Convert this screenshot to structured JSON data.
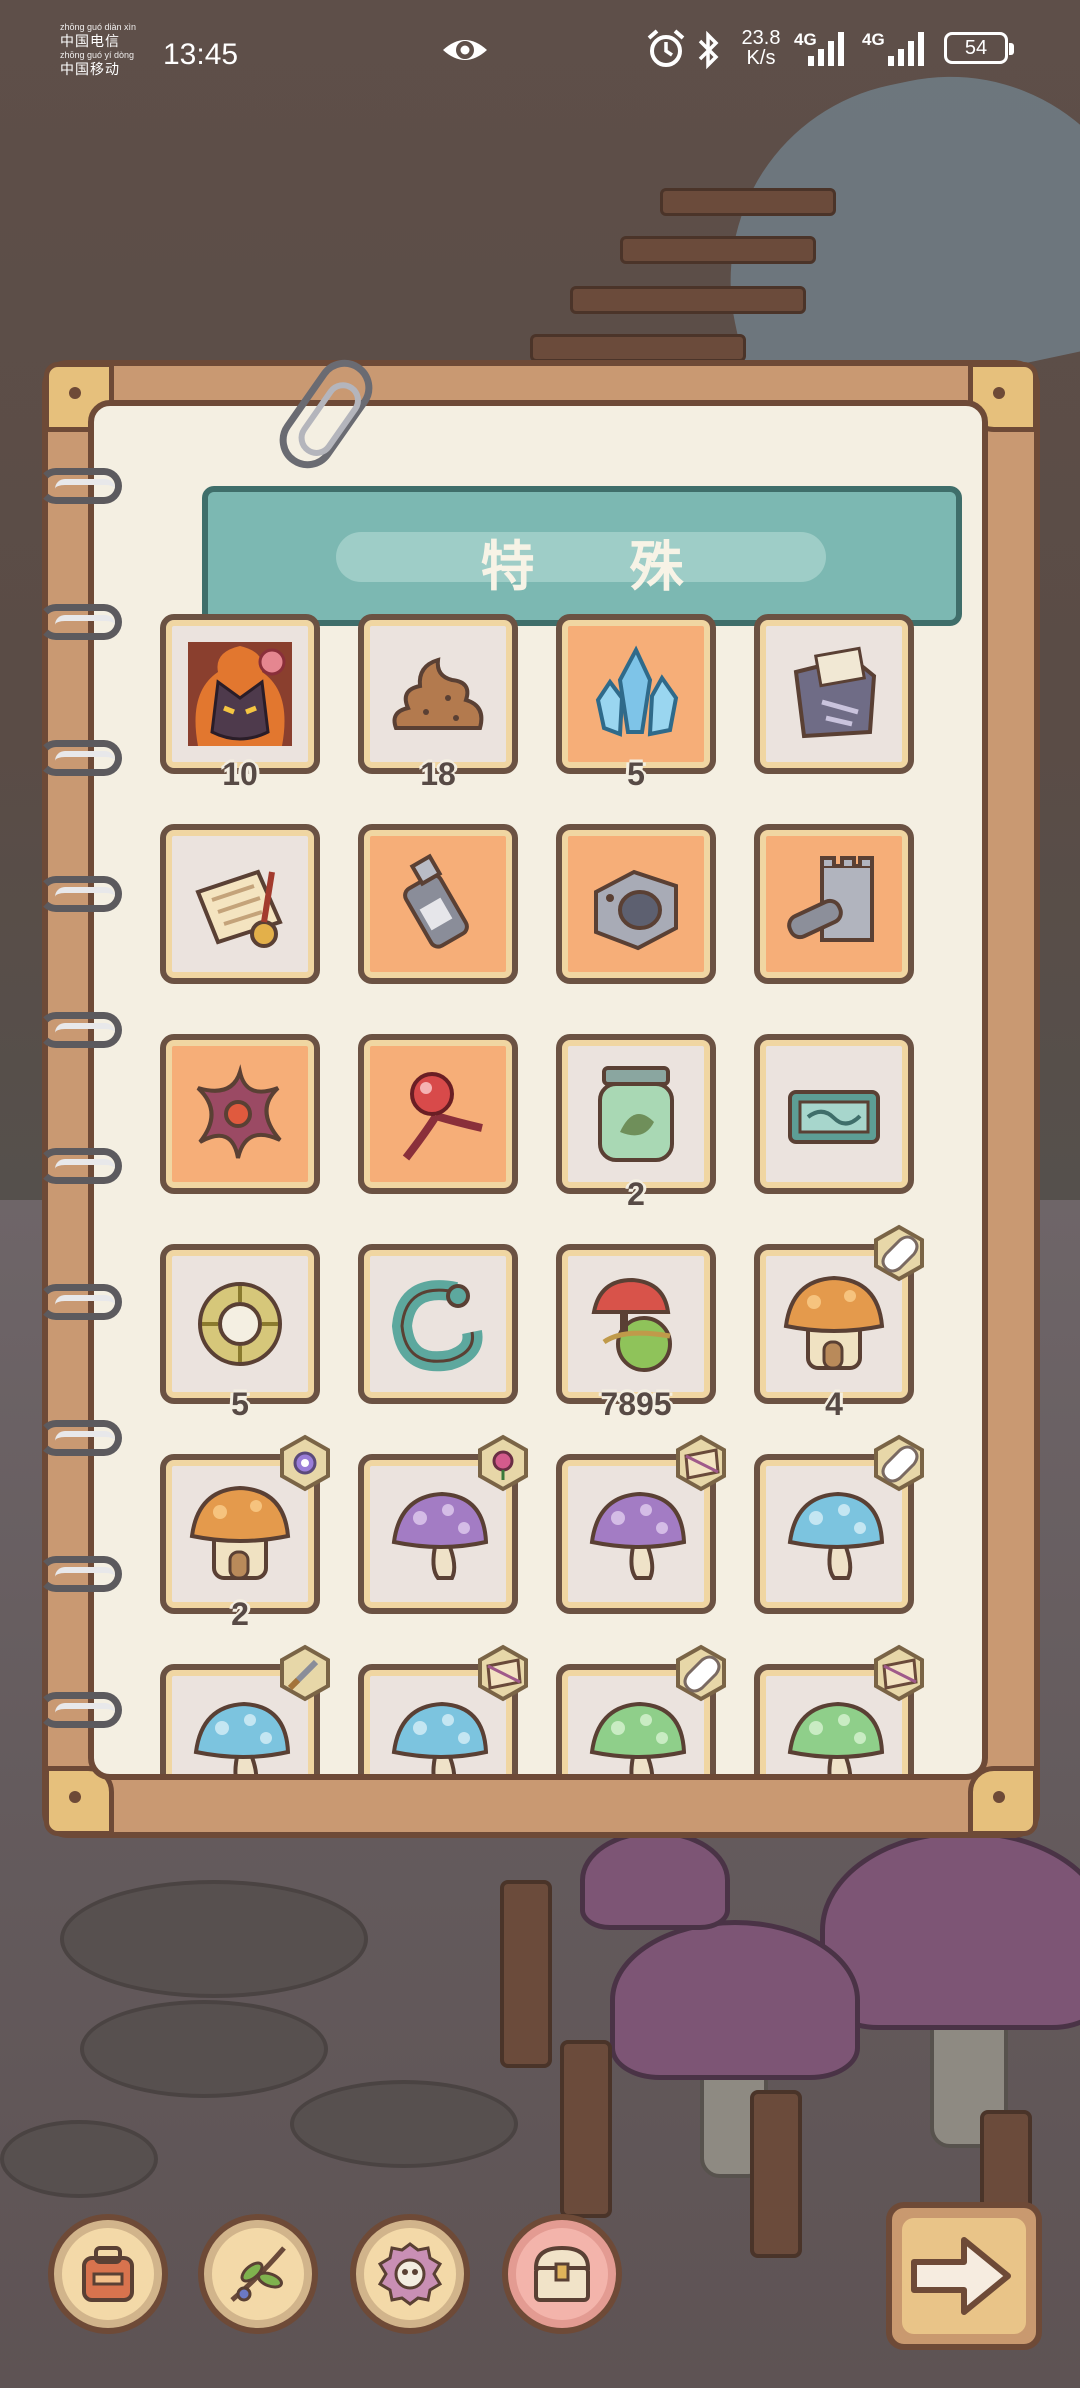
{
  "status_bar": {
    "carrier_1": "中国电信",
    "carrier_1_pinyin": "zhōng guó diàn xìn",
    "carrier_2": "中国移动",
    "carrier_2_pinyin": "zhōng guó yí dòng",
    "time": "13:45",
    "net_speed": "23.8",
    "net_speed_unit": "K/s",
    "network_1": "4G",
    "network_2": "4G",
    "battery": "54",
    "icons": [
      "eye-icon",
      "alarm-icon",
      "bluetooth-icon",
      "signal-icon",
      "battery-icon"
    ]
  },
  "page": {
    "title": "特 殊"
  },
  "items": [
    {
      "icon": "fire-demon-icon",
      "rarity": "normal",
      "count": "10"
    },
    {
      "icon": "poop-icon",
      "rarity": "normal",
      "count": "18"
    },
    {
      "icon": "crystal-icon",
      "rarity": "rare",
      "count": "5"
    },
    {
      "icon": "torn-bag-icon",
      "rarity": "normal",
      "count": ""
    },
    {
      "icon": "scroll-quill-icon",
      "rarity": "normal",
      "count": ""
    },
    {
      "icon": "spray-can-icon",
      "rarity": "rare",
      "count": ""
    },
    {
      "icon": "metal-part-icon",
      "rarity": "rare",
      "count": ""
    },
    {
      "icon": "cannon-tower-icon",
      "rarity": "rare",
      "count": ""
    },
    {
      "icon": "starfish-icon",
      "rarity": "rare",
      "count": ""
    },
    {
      "icon": "red-orb-staff-icon",
      "rarity": "rare",
      "count": ""
    },
    {
      "icon": "specimen-jar-icon",
      "rarity": "normal",
      "count": "2"
    },
    {
      "icon": "teal-box-icon",
      "rarity": "normal",
      "count": ""
    },
    {
      "icon": "jade-ring-icon",
      "rarity": "normal",
      "count": "5"
    },
    {
      "icon": "teal-dragon-ring-icon",
      "rarity": "normal",
      "count": ""
    },
    {
      "icon": "mushroom-potion-icon",
      "rarity": "normal",
      "count": "7895"
    },
    {
      "icon": "orange-mushroom-house-icon",
      "rarity": "normal",
      "count": "4",
      "badge": "pill-badge-icon"
    },
    {
      "icon": "orange-mushroom-house-icon",
      "rarity": "normal",
      "count": "2",
      "badge": "gear-badge-icon"
    },
    {
      "icon": "purple-mushroom-icon",
      "rarity": "normal",
      "count": "",
      "badge": "rose-badge-icon"
    },
    {
      "icon": "purple-mushroom-icon",
      "rarity": "normal",
      "count": "",
      "badge": "book-badge-icon"
    },
    {
      "icon": "blue-mushroom-icon",
      "rarity": "normal",
      "count": "",
      "badge": "pill-badge-icon"
    },
    {
      "icon": "blue-mushroom-icon",
      "rarity": "normal",
      "count": "",
      "badge": "sword-badge-icon"
    },
    {
      "icon": "blue-mushroom-icon",
      "rarity": "normal",
      "count": "",
      "badge": "book-badge-icon"
    },
    {
      "icon": "green-mushroom-icon",
      "rarity": "normal",
      "count": "",
      "badge": "pill-badge-icon"
    },
    {
      "icon": "green-mushroom-icon",
      "rarity": "normal",
      "count": "",
      "badge": "book-badge-icon"
    }
  ],
  "bottom_nav": [
    {
      "icon": "backpack-icon",
      "active": false
    },
    {
      "icon": "herb-branch-icon",
      "active": false
    },
    {
      "icon": "gear-skull-icon",
      "active": false
    },
    {
      "icon": "treasure-chest-icon",
      "active": true
    }
  ],
  "next_button": {
    "icon": "arrow-right-icon"
  },
  "colors": {
    "tile_rare": "#f6ae78",
    "tile_normal": "#ebe3de",
    "banner": "#7cb8b2",
    "book_frame": "#c99972",
    "outline": "#6e4a37"
  }
}
